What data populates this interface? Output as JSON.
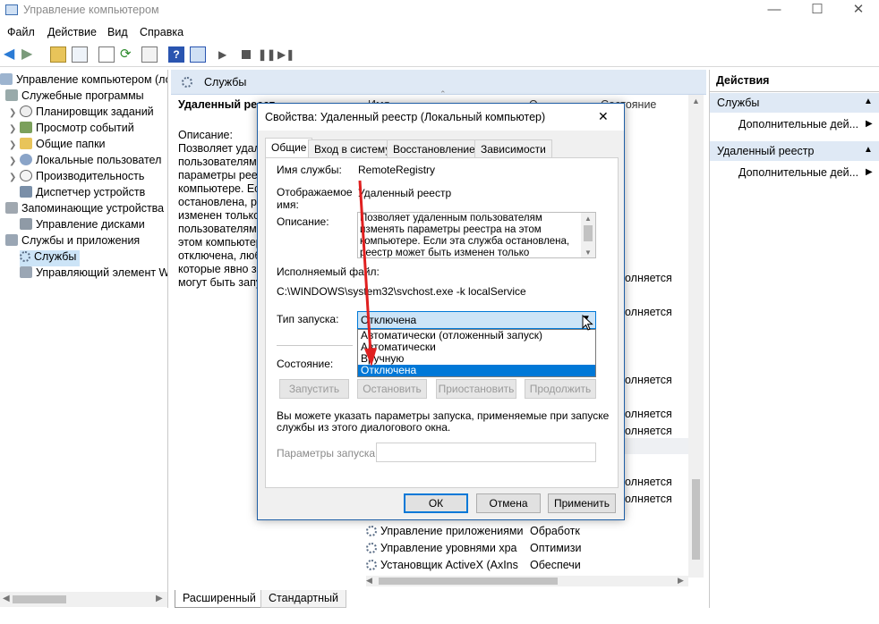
{
  "window": {
    "title": "Управление компьютером",
    "minimize": "—",
    "maximize": "☐",
    "close": "✕"
  },
  "menu": [
    "Файл",
    "Действие",
    "Вид",
    "Справка"
  ],
  "tree": {
    "root": "Управление компьютером (лока",
    "items": [
      {
        "label": "Служебные программы"
      },
      {
        "label": "Планировщик заданий"
      },
      {
        "label": "Просмотр событий"
      },
      {
        "label": "Общие папки"
      },
      {
        "label": "Локальные пользовател"
      },
      {
        "label": "Производительность"
      },
      {
        "label": "Диспетчер устройств"
      },
      {
        "label": "Запоминающие устройства"
      },
      {
        "label": "Управление дисками"
      },
      {
        "label": "Службы и приложения"
      },
      {
        "label": "Службы"
      },
      {
        "label": "Управляющий элемент W"
      }
    ]
  },
  "center": {
    "header": "Службы",
    "service_name": "Удаленный реест",
    "columns": [
      "Имя",
      "О",
      "Состояние"
    ],
    "description_label": "Описание:",
    "description_lines": [
      "Позволяет удале",
      "пользователям м",
      "параметры реест",
      "компьютере. Есл",
      "остановлена, ре",
      "изменен только",
      "пользователями",
      "этом компьютер",
      "отключена, любы",
      "которые явно за",
      "могут быть запу"
    ],
    "side_texts": [
      "олняется",
      "олняется",
      "олняется",
      "олняется",
      "олняется",
      "олняется",
      "олняется"
    ],
    "rows": [
      {
        "name": "Управление приложениями",
        "desc": "Обработк"
      },
      {
        "name": "Управление уровнями хра",
        "desc": "Оптимизи"
      },
      {
        "name": "Установщик ActiveX (AxIns",
        "desc": "Обеспечи"
      }
    ]
  },
  "bottom_tabs": [
    "Расширенный",
    "Стандартный"
  ],
  "actions": {
    "title": "Действия",
    "groups": [
      {
        "label": "Службы",
        "item": "Дополнительные дей..."
      },
      {
        "label": "Удаленный реестр",
        "item": "Дополнительные дей..."
      }
    ]
  },
  "dialog": {
    "title": "Свойства: Удаленный реестр (Локальный компьютер)",
    "tabs": [
      "Общие",
      "Вход в систему",
      "Восстановление",
      "Зависимости"
    ],
    "service_name_label": "Имя службы:",
    "service_name_value": "RemoteRegistry",
    "display_name_label": "Отображаемое имя:",
    "display_name_value": "Удаленный реестр",
    "description_label": "Описание:",
    "description_lines": [
      "Позволяет удаленным пользователям",
      "изменять параметры реестра на этом",
      "компьютере. Если эта служба остановлена,",
      "реестр может быть изменен только"
    ],
    "exe_label": "Исполняемый файл:",
    "exe_value": "C:\\WINDOWS\\system32\\svchost.exe -k localService",
    "startup_label": "Тип запуска:",
    "startup_value": "Отключена",
    "startup_options": [
      "Автоматически (отложенный запуск)",
      "Автоматически",
      "Вручную",
      "Отключена"
    ],
    "status_label": "Состояние:",
    "buttons_service": [
      "Запустить",
      "Остановить",
      "Приостановить",
      "Продолжить"
    ],
    "hint_lines": [
      "Вы можете указать параметры запуска, применяемые при запуске",
      "службы из этого диалогового окна."
    ],
    "params_label": "Параметры запуска:",
    "params_value": "",
    "ok": "ОК",
    "cancel": "Отмена",
    "apply": "Применить",
    "close": "✕"
  },
  "colors": {
    "accent": "#0078d7",
    "arrow": "#e02020",
    "selection": "#cce4f7",
    "header_band": "#dfe9f5"
  }
}
